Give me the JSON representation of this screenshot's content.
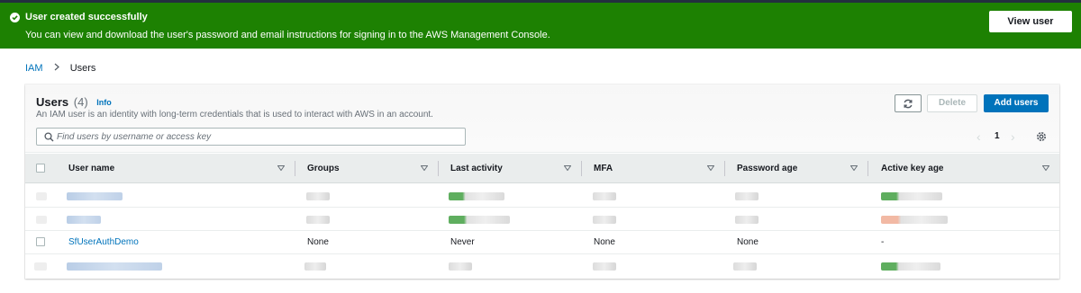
{
  "flash": {
    "title": "User created successfully",
    "message": "You can view and download the user's password and email instructions for signing in to the AWS Management Console.",
    "button": "View user",
    "close_glyph": "✕",
    "icon": "check-circle-icon",
    "color": "#1d8102"
  },
  "breadcrumb": {
    "root": "IAM",
    "current": "Users"
  },
  "panel": {
    "title": "Users",
    "count": "(4)",
    "info": "Info",
    "description": "An IAM user is an identity with long-term credentials that is used to interact with AWS in an account.",
    "refresh_icon": "refresh-icon",
    "delete_label": "Delete",
    "add_label": "Add users",
    "accent": "#0073bb"
  },
  "search": {
    "placeholder": "Find users by username or access key",
    "value": ""
  },
  "pagination": {
    "prev": "‹",
    "page": "1",
    "next": "›"
  },
  "table": {
    "columns": [
      "User name",
      "Groups",
      "Last activity",
      "MFA",
      "Password age",
      "Active key age"
    ],
    "rows": [
      {
        "redacted": true
      },
      {
        "redacted": true
      },
      {
        "redacted": false,
        "user_name": "SfUserAuthDemo",
        "groups": "None",
        "last_activity": "Never",
        "mfa": "None",
        "password_age": "None",
        "active_key_age": "-"
      },
      {
        "redacted": true
      }
    ]
  }
}
